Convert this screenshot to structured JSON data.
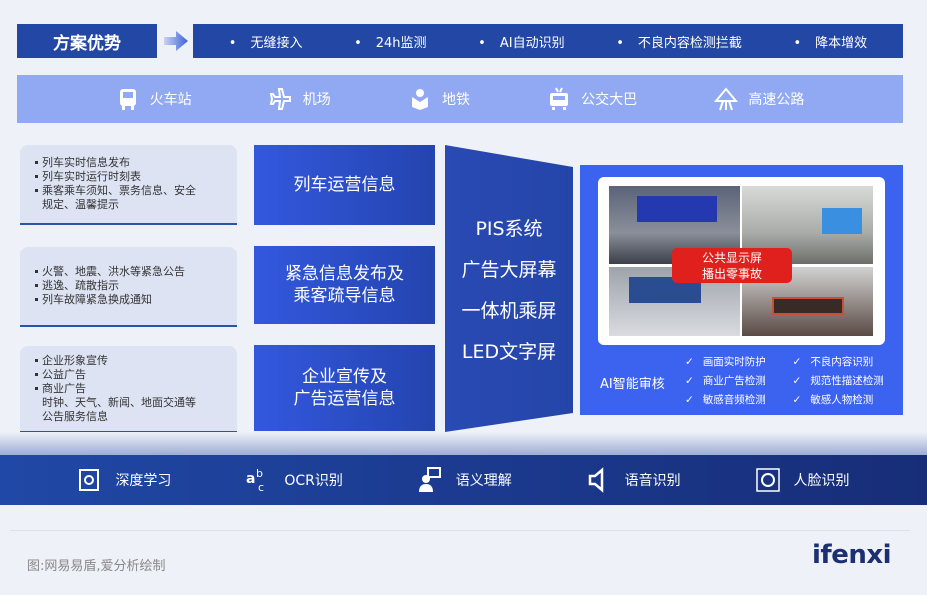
{
  "advantages": {
    "title": "方案优势",
    "items": [
      "无缝接入",
      "24h监测",
      "AI自动识别",
      "不良内容检测拦截",
      "降本增效"
    ]
  },
  "scenes": [
    {
      "label": "火车站",
      "icon": "train-icon"
    },
    {
      "label": "机场",
      "icon": "plane-icon"
    },
    {
      "label": "地铁",
      "icon": "metro-icon"
    },
    {
      "label": "公交大巴",
      "icon": "bus-icon"
    },
    {
      "label": "高速公路",
      "icon": "highway-icon"
    }
  ],
  "cards": [
    {
      "lines": [
        "列车实时信息发布",
        "列车实时运行时刻表",
        "乘客乘车须知、票务信息、安全",
        "规定、温馨提示"
      ]
    },
    {
      "lines": [
        "火警、地震、洪水等紧急公告",
        "逃逸、疏散指示",
        "列车故障紧急换成通知"
      ]
    },
    {
      "lines": [
        "企业形象宣传",
        "公益广告",
        "商业广告",
        "时钟、天气、新闻、地面交通等",
        "公告服务信息"
      ]
    }
  ],
  "categories": [
    {
      "l1": "列车运营信息",
      "l2": ""
    },
    {
      "l1": "紧急信息发布及",
      "l2": "乘客疏导信息"
    },
    {
      "l1": "企业宣传及",
      "l2": "广告运营信息"
    }
  ],
  "systems": [
    "PIS系统",
    "广告大屏幕",
    "一体机乘屏",
    "LED文字屏"
  ],
  "badge": {
    "l1": "公共显示屏",
    "l2": "播出零事故"
  },
  "ai": {
    "label": "AI智能审核",
    "items": [
      "画面实时防护",
      "不良内容识别",
      "商业广告检测",
      "规范性描述检测",
      "敏感音频检测",
      "敏感人物检测"
    ]
  },
  "tech": [
    {
      "label": "深度学习"
    },
    {
      "label": "OCR识别"
    },
    {
      "label": "语义理解"
    },
    {
      "label": "语音识别"
    },
    {
      "label": "人脸识别"
    }
  ],
  "footer": {
    "source": "图:网易易盾,爱分析绘制",
    "logo": "ifenxi"
  }
}
